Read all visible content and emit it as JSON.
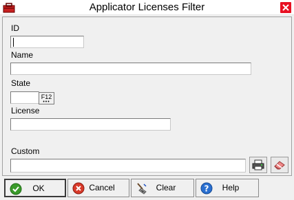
{
  "window": {
    "title": "Applicator Licenses Filter"
  },
  "fields": {
    "id": {
      "label": "ID",
      "value": ""
    },
    "name": {
      "label": "Name",
      "value": ""
    },
    "state": {
      "label": "State",
      "value": "",
      "lookup_label": "F12"
    },
    "license": {
      "label": "License",
      "value": ""
    },
    "custom": {
      "label": "Custom",
      "value": ""
    }
  },
  "buttons": {
    "ok": "OK",
    "cancel": "Cancel",
    "clear": "Clear",
    "help": "Help"
  },
  "icons": {
    "app": "toolbox-icon",
    "close": "close-icon",
    "printer": "printer-icon",
    "eraser": "eraser-icon",
    "ok": "check-icon",
    "cancel": "cancel-icon",
    "clear": "broom-icon",
    "help": "help-icon"
  },
  "colors": {
    "ok_green": "#3a9a2a",
    "cancel_red": "#d83a2a",
    "help_blue": "#2a6fd0",
    "close_red": "#e81123"
  }
}
